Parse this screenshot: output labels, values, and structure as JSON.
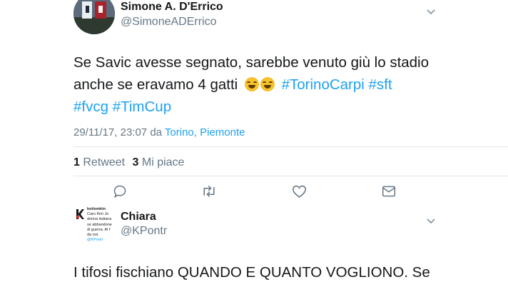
{
  "tweet1": {
    "author_name": "Simone A. D'Errico",
    "author_handle": "@SimoneADErrico",
    "text_line1": "Se Savic avesse segnato, sarebbe venuto giù lo stadio",
    "text_line2_start": "anche se eravamo 4 gatti",
    "emoji": "😂😂",
    "hashtags_line2": "#TorinoCarpi #sft",
    "hashtags_line3": "#fvcg #TimCup",
    "date": "29/11/17, 23:07 da",
    "location_city": "Torino",
    "location_sep": ",",
    "location_region": "Piemonte",
    "retweet_count": "1",
    "retweet_label": "Retweet",
    "like_count": "3",
    "like_label": "Mi piace"
  },
  "tweet2": {
    "author_name": "Chiara",
    "author_handle": "@KPontr",
    "avatar_text": [
      "kotiomkin",
      "Caro Kim Jo",
      "donna italiana",
      "se abbandone",
      "di guerra. Al f",
      "da noi.",
      "@KPontr"
    ],
    "text_line1": "I tifosi fischiano QUANDO E QUANTO VOGLIONO. Se"
  },
  "colors": {
    "accent": "#1da1f2",
    "text": "#14171a",
    "muted": "#657786",
    "divider": "#e1e8ed"
  },
  "icons": [
    "chevron-down-icon",
    "reply-icon",
    "retweet-icon",
    "like-icon",
    "message-icon"
  ]
}
